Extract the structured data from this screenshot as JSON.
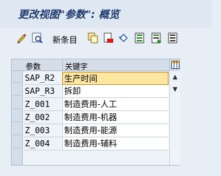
{
  "window": {
    "title": "更改视图\"参数\": 概览"
  },
  "toolbar": {
    "new_entries_label": "新条目"
  },
  "table": {
    "columns": [
      "参数",
      "关键字"
    ],
    "rows": [
      {
        "param": "SAP_R2",
        "keyword": "生产时间"
      },
      {
        "param": "SAP_R3",
        "keyword": "拆卸"
      },
      {
        "param": "Z_001",
        "keyword": "制造费用-人工"
      },
      {
        "param": "Z_002",
        "keyword": "制造费用-机器"
      },
      {
        "param": "Z_003",
        "keyword": "制造费用-能源"
      },
      {
        "param": "Z_004",
        "keyword": "制造费用-辅料"
      }
    ]
  },
  "icons": {
    "toolbar": [
      "edit-icon",
      "display-change-icon",
      "copy-icon",
      "delete-icon",
      "undo-icon",
      "select-all-icon",
      "select-block-icon",
      "deselect-all-icon"
    ],
    "table": [
      "column-settings-icon",
      "scroll-up-icon",
      "scroll-down-icon"
    ]
  },
  "colors": {
    "accent": "#1f3a6b",
    "selected_cell": "#fde6a0"
  }
}
